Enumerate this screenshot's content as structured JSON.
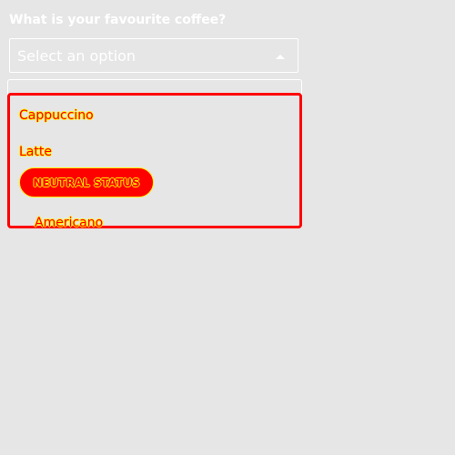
{
  "form": {
    "question": "What is your favourite coffee?",
    "select_placeholder": "Select an option",
    "caret_icon": "caret-up-icon"
  },
  "dropdown": {
    "options": [
      {
        "label": "Cappuccino"
      },
      {
        "label": "Latte"
      },
      {
        "label": "Americano"
      }
    ],
    "status_badge": "NEUTRAL STATUS"
  },
  "colors": {
    "background": "#e6e6e6",
    "text": "#ffffff",
    "highlight": "#ff0000",
    "outline": "#ffee00"
  }
}
